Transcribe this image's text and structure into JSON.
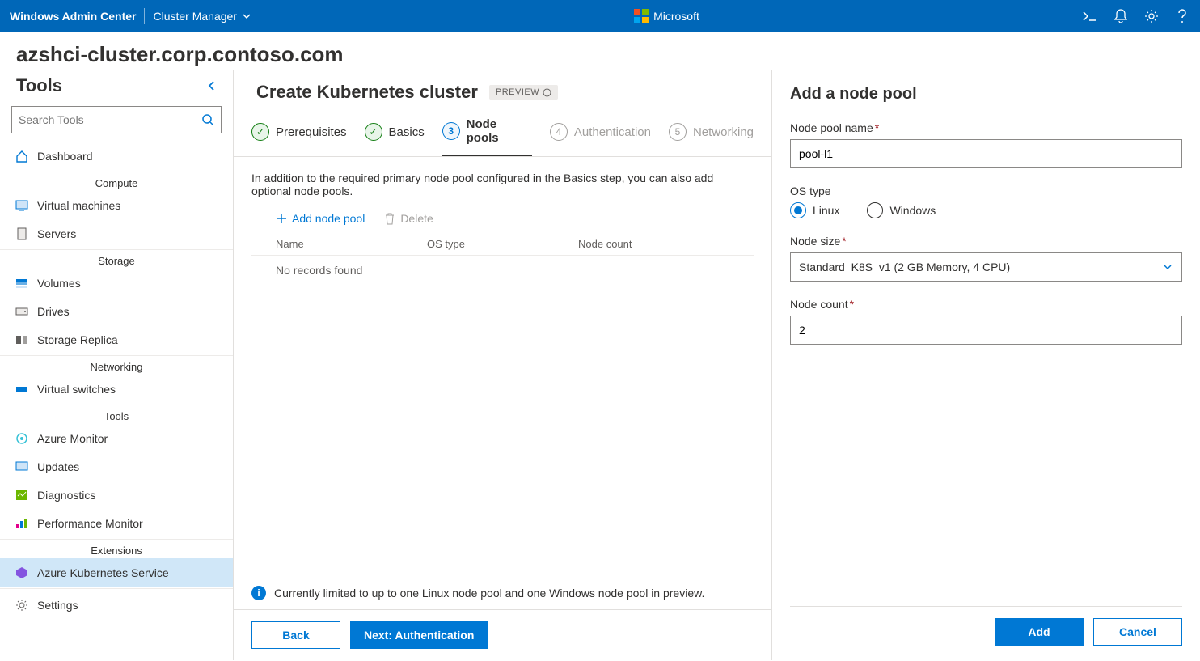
{
  "topbar": {
    "title": "Windows Admin Center",
    "context": "Cluster Manager",
    "brand": "Microsoft"
  },
  "host": "azshci-cluster.corp.contoso.com",
  "sidebar": {
    "title": "Tools",
    "search_placeholder": "Search Tools",
    "items": [
      {
        "label": "Dashboard"
      }
    ],
    "groups": {
      "compute": {
        "label": "Compute",
        "items": [
          "Virtual machines",
          "Servers"
        ]
      },
      "storage": {
        "label": "Storage",
        "items": [
          "Volumes",
          "Drives",
          "Storage Replica"
        ]
      },
      "networking": {
        "label": "Networking",
        "items": [
          "Virtual switches"
        ]
      },
      "tools": {
        "label": "Tools",
        "items": [
          "Azure Monitor",
          "Updates",
          "Diagnostics",
          "Performance Monitor"
        ]
      },
      "extensions": {
        "label": "Extensions",
        "items": [
          "Azure Kubernetes Service"
        ]
      }
    },
    "settings": "Settings"
  },
  "wizard": {
    "title": "Create Kubernetes cluster",
    "badge": "PREVIEW",
    "steps": {
      "s1": "Prerequisites",
      "s2": "Basics",
      "s3": "Node pools",
      "s4": "Authentication",
      "s5": "Networking"
    },
    "intro": "In addition to the required primary node pool configured in the Basics step, you can also add optional node pools.",
    "toolbar": {
      "add": "Add node pool",
      "delete": "Delete"
    },
    "columns": {
      "name": "Name",
      "os": "OS type",
      "count": "Node count"
    },
    "empty": "No records found",
    "info": "Currently limited to up to one Linux node pool and one Windows node pool in preview.",
    "footer": {
      "back": "Back",
      "next": "Next: Authentication"
    }
  },
  "panel": {
    "title": "Add a node pool",
    "labels": {
      "name": "Node pool name",
      "os": "OS type",
      "size": "Node size",
      "count": "Node count"
    },
    "name_value": "pool-l1",
    "os_options": {
      "linux": "Linux",
      "windows": "Windows"
    },
    "os_selected": "linux",
    "size_value": "Standard_K8S_v1 (2 GB Memory, 4 CPU)",
    "count_value": "2",
    "footer": {
      "add": "Add",
      "cancel": "Cancel"
    }
  }
}
